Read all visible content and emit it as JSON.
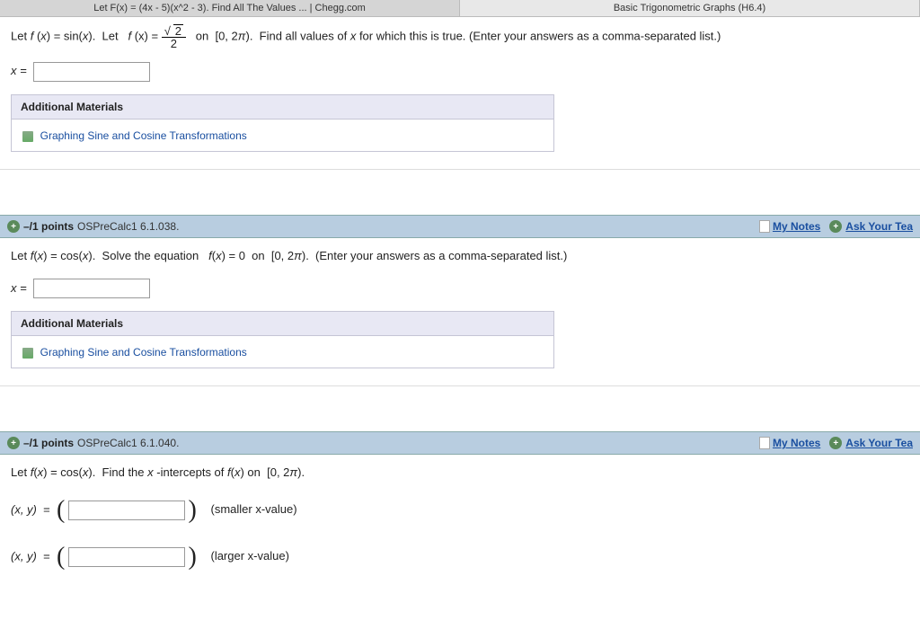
{
  "tabs": {
    "left": "Let F(x) = (4x - 5)(x^2 - 3). Find All The Values ... | Chegg.com",
    "right": "Basic Trigonometric Graphs (H6.4)"
  },
  "q1": {
    "text1": "Let  ",
    "fx": "f",
    "eq1": "(x) = sin(x).  Let  ",
    "eq2": "(x) = ",
    "sqrt_val": "2",
    "den": "2",
    "text2": " on  [0, 2π).  Find all values of ",
    "xvar": "x",
    "text3": " for which this is true. (Enter your answers as a comma-separated list.)",
    "xlabel": "x =",
    "mat_header": "Additional Materials",
    "mat_link": "Graphing Sine and Cosine Transformations"
  },
  "q2": {
    "points": "–/1 points",
    "source": "OSPreCalc1 6.1.038.",
    "notes": "My Notes",
    "ask": "Ask Your Tea",
    "text1": "Let  ",
    "eq1": "(x) = cos(x).  Solve the equation  ",
    "eq2": "(x) = 0  on  [0, 2π).  (Enter your answers as a comma-separated list.)",
    "xlabel": "x =",
    "mat_header": "Additional Materials",
    "mat_link": "Graphing Sine and Cosine Transformations"
  },
  "q3": {
    "points": "–/1 points",
    "source": "OSPreCalc1 6.1.040.",
    "notes": "My Notes",
    "ask": "Ask Your Tea",
    "text1": "Let  ",
    "eq1": "(x) = cos(x).  Find the ",
    "xint": "x",
    "text2": "-intercepts of ",
    "eq2": "(x) on  [0, 2π).",
    "xy": "(x, y)  =",
    "smaller": "(smaller x-value)",
    "larger": "(larger x-value)"
  }
}
